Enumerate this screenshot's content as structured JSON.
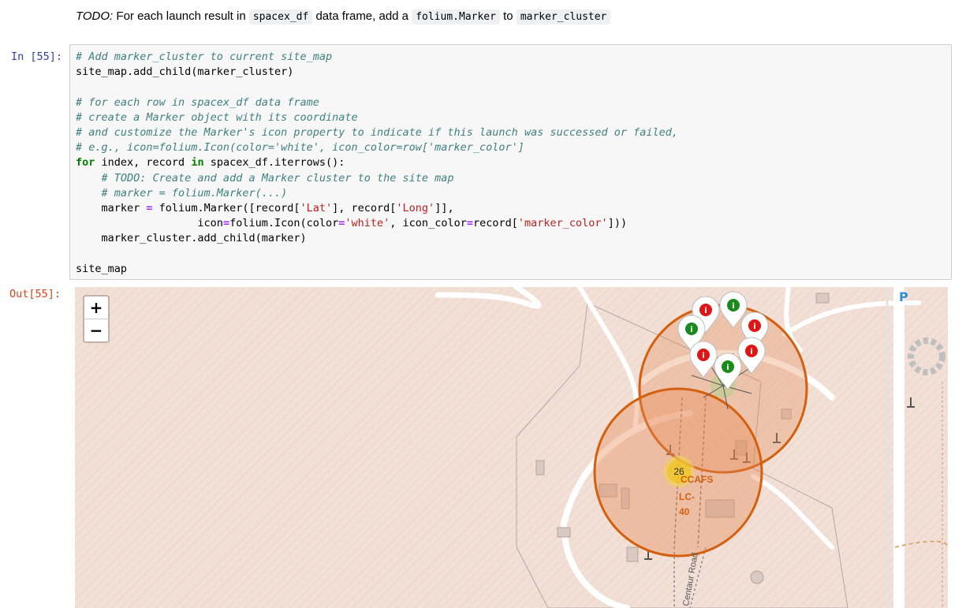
{
  "markdown": {
    "todo_label": "TODO:",
    "text1": " For each launch result in ",
    "code1": "spacex_df",
    "text2": " data frame, add a ",
    "code2": "folium.Marker",
    "text3": " to ",
    "code3": "marker_cluster"
  },
  "cell": {
    "in_prompt": "In [55]:",
    "out_prompt": "Out[55]:",
    "code": {
      "l1": "# Add marker_cluster to current site_map",
      "l2": "site_map.add_child(marker_cluster)",
      "l4": "# for each row in spacex_df data frame",
      "l5": "# create a Marker object with its coordinate",
      "l6": "# and customize the Marker's icon property to indicate if this launch was successed or failed,",
      "l7": "# e.g., icon=folium.Icon(color='white', icon_color=row['marker_color']",
      "l8_for": "for",
      "l8_a": " index, record ",
      "l8_in": "in",
      "l8_b": " spacex_df.iterrows():",
      "l9": "    # TODO: Create and add a Marker cluster to the site map",
      "l10": "    # marker = folium.Marker(...)",
      "l11_a": "    marker ",
      "l11_eq": "=",
      "l11_b": " folium.Marker([record[",
      "l11_s1": "'Lat'",
      "l11_c": "], record[",
      "l11_s2": "'Long'",
      "l11_d": "]],",
      "l12_a": "                   icon",
      "l12_eq1": "=",
      "l12_b": "folium.Icon(color",
      "l12_eq2": "=",
      "l12_s1": "'white'",
      "l12_c": ", icon_color",
      "l12_eq3": "=",
      "l12_d": "record[",
      "l12_s2": "'marker_color'",
      "l12_e": "]))",
      "l13": "    marker_cluster.add_child(marker)",
      "l15": "site_map"
    }
  },
  "map": {
    "zoom_in": "+",
    "zoom_out": "−",
    "cluster_count": "26",
    "site_label_line1": "CCAFS",
    "site_label_line2": "LC-",
    "site_label_line3": "40",
    "road_label": "Centaur Road",
    "parking_label": "P",
    "marker_glyph": "i",
    "colors": {
      "success": "#1a8a1a",
      "failure": "#e01616",
      "cluster_ring": "#d2600f"
    },
    "markers": [
      {
        "status": "failure"
      },
      {
        "status": "success"
      },
      {
        "status": "failure"
      },
      {
        "status": "success"
      },
      {
        "status": "failure"
      },
      {
        "status": "failure"
      },
      {
        "status": "success"
      }
    ]
  }
}
